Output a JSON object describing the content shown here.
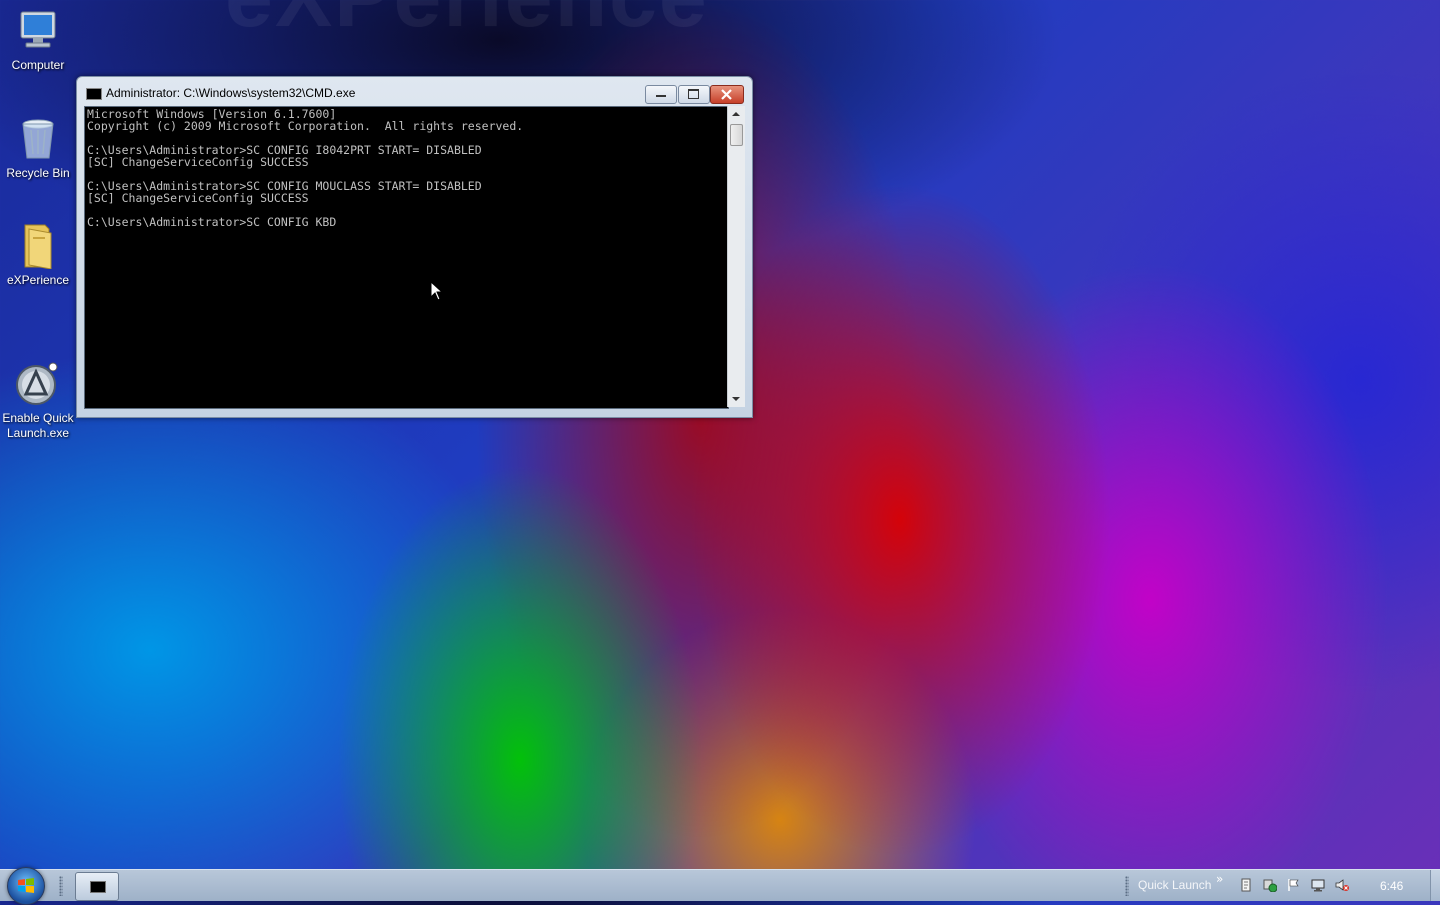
{
  "wallpaper": {
    "watermark": "eXPerience"
  },
  "desktop_icons": [
    {
      "label": "Computer",
      "icon": "computer-icon"
    },
    {
      "label": "Recycle Bin",
      "icon": "recycle-bin-icon"
    },
    {
      "label": "eXPerience",
      "icon": "folder-icon"
    },
    {
      "label": "Enable Quick\nLaunch.exe",
      "icon": "app-icon"
    }
  ],
  "window": {
    "title": "Administrator: C:\\Windows\\system32\\CMD.exe",
    "console_output": "Microsoft Windows [Version 6.1.7600]\nCopyright (c) 2009 Microsoft Corporation.  All rights reserved.\n\nC:\\Users\\Administrator>SC CONFIG I8042PRT START= DISABLED\n[SC] ChangeServiceConfig SUCCESS\n\nC:\\Users\\Administrator>SC CONFIG MOUCLASS START= DISABLED\n[SC] ChangeServiceConfig SUCCESS\n\nC:\\Users\\Administrator>SC CONFIG KBD"
  },
  "taskbar": {
    "quick_launch_label": "Quick Launch",
    "chevron": "»",
    "clock": "6:46",
    "colors": {
      "bar": "#a9bbd0",
      "text": "#ffffff"
    }
  }
}
